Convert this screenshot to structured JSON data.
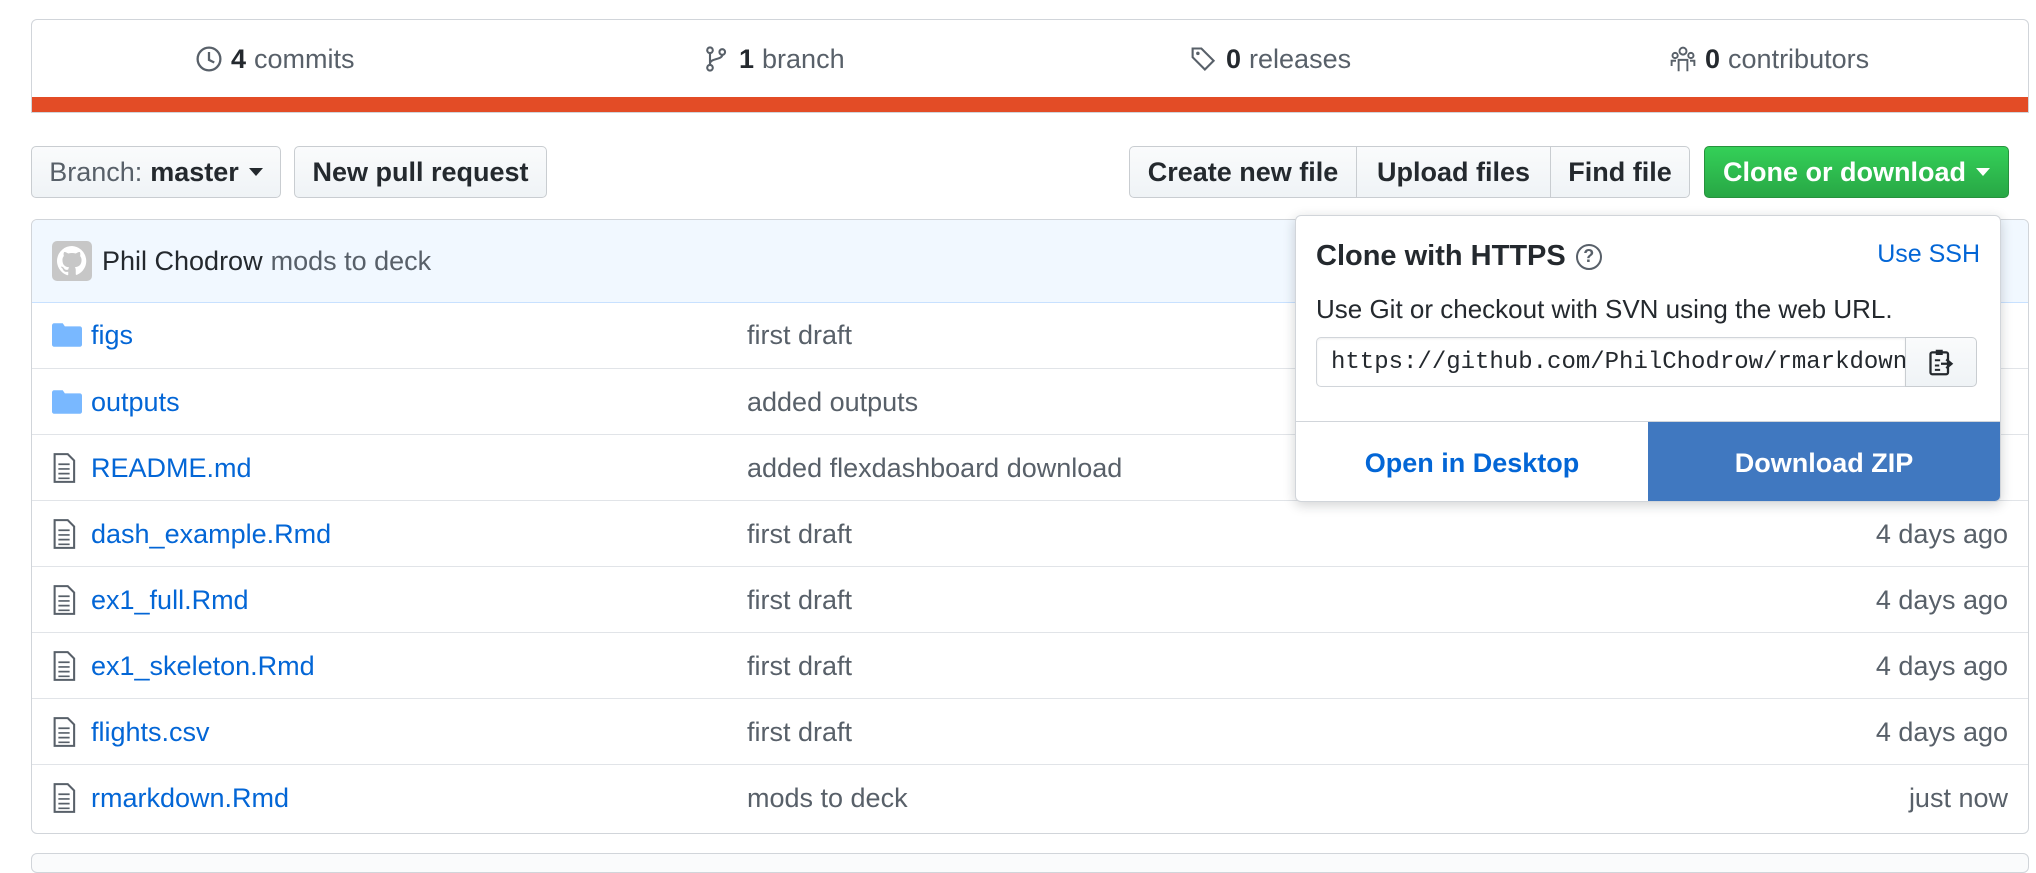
{
  "summary": {
    "commits": {
      "count": "4",
      "label": "commits",
      "icon": "history-icon"
    },
    "branches": {
      "count": "1",
      "label": "branch",
      "icon": "git-branch-icon"
    },
    "releases": {
      "count": "0",
      "label": "releases",
      "icon": "tag-icon"
    },
    "contributors": {
      "count": "0",
      "label": "contributors",
      "icon": "organization-icon"
    },
    "language_bar_color": "#e34c26"
  },
  "toolbar": {
    "branch_label": "Branch:",
    "branch_name": "master",
    "new_pull_request": "New pull request",
    "create_new_file": "Create new file",
    "upload_files": "Upload files",
    "find_file": "Find file",
    "clone_or_download": "Clone or download"
  },
  "latest_commit": {
    "author": "Phil Chodrow",
    "message": "mods to deck"
  },
  "files": [
    {
      "type": "folder",
      "name": "figs",
      "message": "first draft",
      "age": ""
    },
    {
      "type": "folder",
      "name": "outputs",
      "message": "added outputs",
      "age": ""
    },
    {
      "type": "file",
      "name": "README.md",
      "message": "added flexdashboard download",
      "age": ""
    },
    {
      "type": "file",
      "name": "dash_example.Rmd",
      "message": "first draft",
      "age": "4 days ago"
    },
    {
      "type": "file",
      "name": "ex1_full.Rmd",
      "message": "first draft",
      "age": "4 days ago"
    },
    {
      "type": "file",
      "name": "ex1_skeleton.Rmd",
      "message": "first draft",
      "age": "4 days ago"
    },
    {
      "type": "file",
      "name": "flights.csv",
      "message": "first draft",
      "age": "4 days ago"
    },
    {
      "type": "file",
      "name": "rmarkdown.Rmd",
      "message": "mods to deck",
      "age": "just now"
    }
  ],
  "clone_popover": {
    "title": "Clone with HTTPS",
    "use_ssh": "Use SSH",
    "description": "Use Git or checkout with SVN using the web URL.",
    "url": "https://github.com/PhilChodrow/rmarkdown",
    "open_in_desktop": "Open in Desktop",
    "download_zip": "Download ZIP"
  },
  "colors": {
    "link": "#0366d6",
    "green_button": "#28a745",
    "download_zip_bg": "#4078c0",
    "folder_icon": "#79b8ff"
  }
}
